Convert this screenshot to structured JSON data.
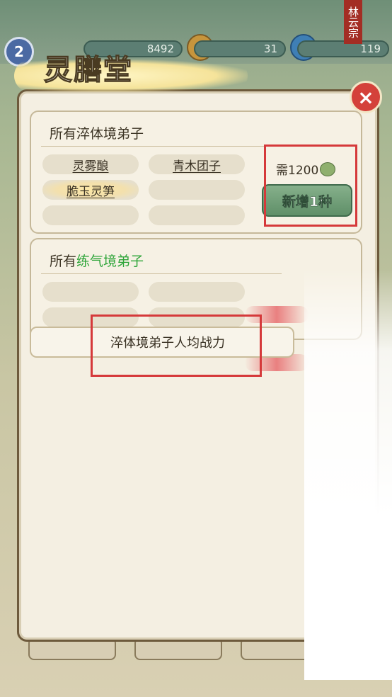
{
  "header": {
    "level": "2",
    "resources": [
      {
        "name": "resource-1",
        "value": "8492"
      },
      {
        "name": "resource-2",
        "value": "31"
      },
      {
        "name": "resource-3",
        "value": "119"
      }
    ],
    "sect_tag": "林云宗"
  },
  "panel": {
    "title": "灵膳堂",
    "close": "×"
  },
  "tier1": {
    "title": "所有淬体境弟子",
    "slots": [
      "灵雾酿",
      "青木团子",
      "脆玉灵笋",
      "",
      "",
      ""
    ],
    "cost_prefix": "需",
    "cost": "1200",
    "add_button": "新增1种"
  },
  "tier2": {
    "title_prefix": "所有",
    "title_highlight": "练气境弟子",
    "title_color": "#2fa53a",
    "slots": [
      "",
      "",
      "",
      ""
    ]
  },
  "tooltip": {
    "text": "淬体境弟子人均战力"
  },
  "colors": {
    "accent_red": "#d5393a",
    "button_green": "#5f8f68"
  }
}
